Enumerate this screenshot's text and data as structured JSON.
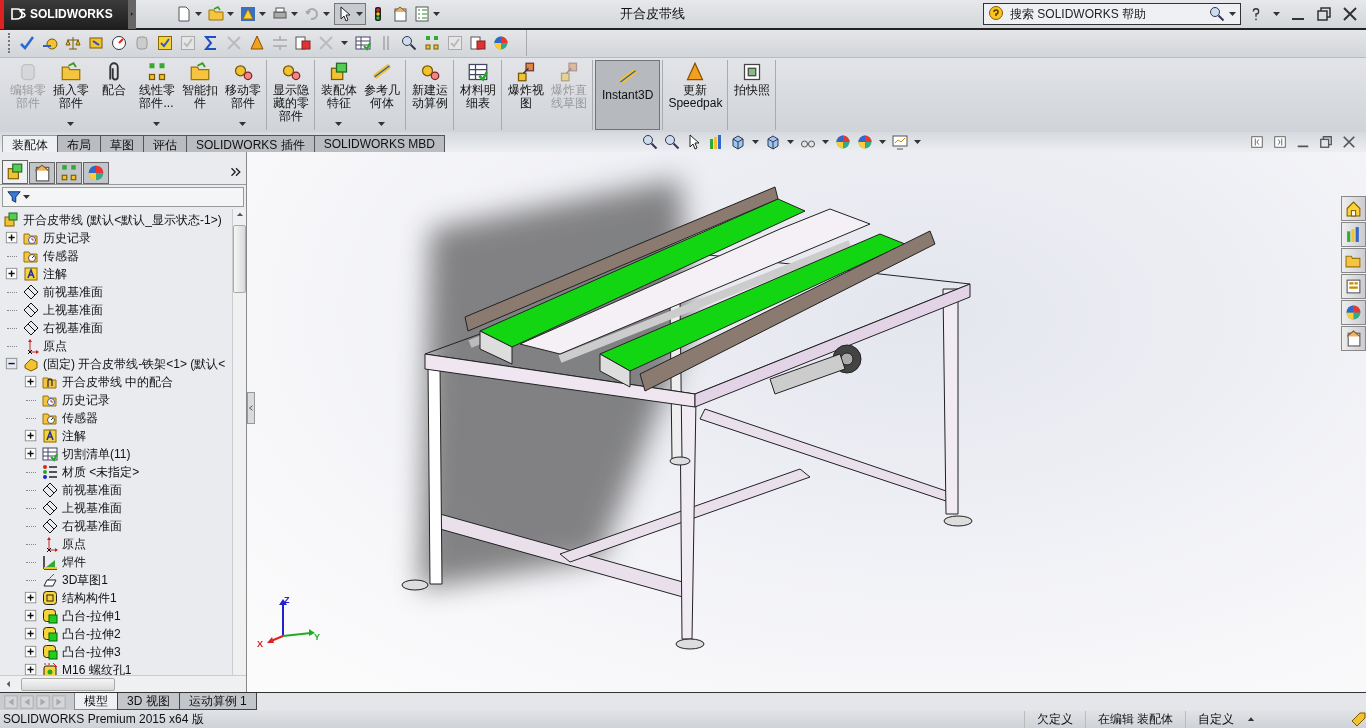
{
  "title_bar": {
    "logo": "SOLIDWORKS",
    "title": "开合皮带线",
    "search": {
      "placeholder": "搜索 SOLIDWORKS 帮助"
    }
  },
  "ribbon": {
    "groups": [
      [
        {
          "label": "编辑零部件",
          "disabled": true,
          "has_menu": false,
          "selected": false
        },
        {
          "label": "插入零部件",
          "disabled": false,
          "has_menu": true,
          "selected": false
        },
        {
          "label": "配合",
          "disabled": false,
          "has_menu": false,
          "selected": false
        },
        {
          "label": "线性零部件...",
          "disabled": false,
          "has_menu": true,
          "selected": false
        },
        {
          "label": "智能扣件",
          "disabled": false,
          "has_menu": false,
          "selected": false
        },
        {
          "label": "移动零部件",
          "disabled": false,
          "has_menu": true,
          "selected": false
        }
      ],
      [
        {
          "label": "显示隐藏的零部件",
          "disabled": false,
          "has_menu": false,
          "selected": false
        }
      ],
      [
        {
          "label": "装配体特征",
          "disabled": false,
          "has_menu": true,
          "selected": false
        },
        {
          "label": "参考几何体",
          "disabled": false,
          "has_menu": true,
          "selected": false
        }
      ],
      [
        {
          "label": "新建运动算例",
          "disabled": false,
          "has_menu": false,
          "selected": false
        }
      ],
      [
        {
          "label": "材料明细表",
          "disabled": false,
          "has_menu": false,
          "selected": false
        }
      ],
      [
        {
          "label": "爆炸视图",
          "disabled": false,
          "has_menu": false,
          "selected": false
        },
        {
          "label": "爆炸直线草图",
          "disabled": true,
          "has_menu": false,
          "selected": false
        }
      ],
      [
        {
          "label": "Instant3D",
          "disabled": false,
          "has_menu": false,
          "selected": true
        }
      ],
      [
        {
          "label": "更新 Speedpak",
          "disabled": false,
          "has_menu": false,
          "selected": false
        }
      ],
      [
        {
          "label": "拍快照",
          "disabled": false,
          "has_menu": false,
          "selected": false
        }
      ]
    ]
  },
  "command_tabs": [
    {
      "label": "装配体",
      "selected": true
    },
    {
      "label": "布局",
      "selected": false
    },
    {
      "label": "草图",
      "selected": false
    },
    {
      "label": "评估",
      "selected": false
    },
    {
      "label": "SOLIDWORKS 插件",
      "selected": false
    },
    {
      "label": "SOLIDWORKS MBD",
      "selected": false
    }
  ],
  "feature_tree": {
    "panel_tabs": [
      {
        "kind": "features",
        "selected": true
      },
      {
        "kind": "properties",
        "selected": false
      },
      {
        "kind": "configurations",
        "selected": false
      },
      {
        "kind": "display",
        "selected": false
      }
    ],
    "root": {
      "label": "开合皮带线  (默认<默认_显示状态-1>)",
      "kind": "assembly",
      "children": [
        {
          "label": "历史记录",
          "kind": "history",
          "expandable": true,
          "expanded": false
        },
        {
          "label": "传感器",
          "kind": "sensor",
          "expandable": false
        },
        {
          "label": "注解",
          "kind": "annotation",
          "expandable": true,
          "expanded": false
        },
        {
          "label": "前视基准面",
          "kind": "plane",
          "expandable": false
        },
        {
          "label": "上视基准面",
          "kind": "plane",
          "expandable": false
        },
        {
          "label": "右视基准面",
          "kind": "plane",
          "expandable": false
        },
        {
          "label": "原点",
          "kind": "origin",
          "expandable": false
        },
        {
          "label": "(固定) 开合皮带线-铁架<1> (默认<",
          "kind": "part",
          "expandable": true,
          "expanded": true,
          "children": [
            {
              "label": "开合皮带线 中的配合",
              "kind": "mates",
              "expandable": true,
              "expanded": false
            },
            {
              "label": "历史记录",
              "kind": "history",
              "expandable": false
            },
            {
              "label": "传感器",
              "kind": "sensor",
              "expandable": false
            },
            {
              "label": "注解",
              "kind": "annotation",
              "expandable": true,
              "expanded": false
            },
            {
              "label": "切割清单(11)",
              "kind": "cutlist",
              "expandable": true,
              "expanded": false
            },
            {
              "label": "材质 <未指定>",
              "kind": "material",
              "expandable": false
            },
            {
              "label": "前视基准面",
              "kind": "plane",
              "expandable": false
            },
            {
              "label": "上视基准面",
              "kind": "plane",
              "expandable": false
            },
            {
              "label": "右视基准面",
              "kind": "plane",
              "expandable": false
            },
            {
              "label": "原点",
              "kind": "origin",
              "expandable": false
            },
            {
              "label": "焊件",
              "kind": "weldment",
              "expandable": false
            },
            {
              "label": "3D草图1",
              "kind": "sketch3d",
              "expandable": false
            },
            {
              "label": "结构构件1",
              "kind": "structure",
              "expandable": true,
              "expanded": false
            },
            {
              "label": "凸台-拉伸1",
              "kind": "extrude",
              "expandable": true,
              "expanded": false
            },
            {
              "label": "凸台-拉伸2",
              "kind": "extrude",
              "expandable": true,
              "expanded": false
            },
            {
              "label": "凸台-拉伸3",
              "kind": "extrude",
              "expandable": true,
              "expanded": false
            },
            {
              "label": "M16 螺纹孔1",
              "kind": "hole",
              "expandable": true,
              "expanded": false
            }
          ]
        }
      ]
    }
  },
  "viewport": {
    "triad": {
      "z": "Z",
      "y": "Y",
      "x": "X"
    }
  },
  "bottom_tabs": [
    {
      "label": "模型",
      "selected": true
    },
    {
      "label": "3D 视图",
      "selected": false
    },
    {
      "label": "运动算例 1",
      "selected": false
    }
  ],
  "status_bar": {
    "product": "SOLIDWORKS Premium 2015 x64 版",
    "fields": [
      "欠定义",
      "在编辑 装配体",
      "自定义"
    ]
  }
}
